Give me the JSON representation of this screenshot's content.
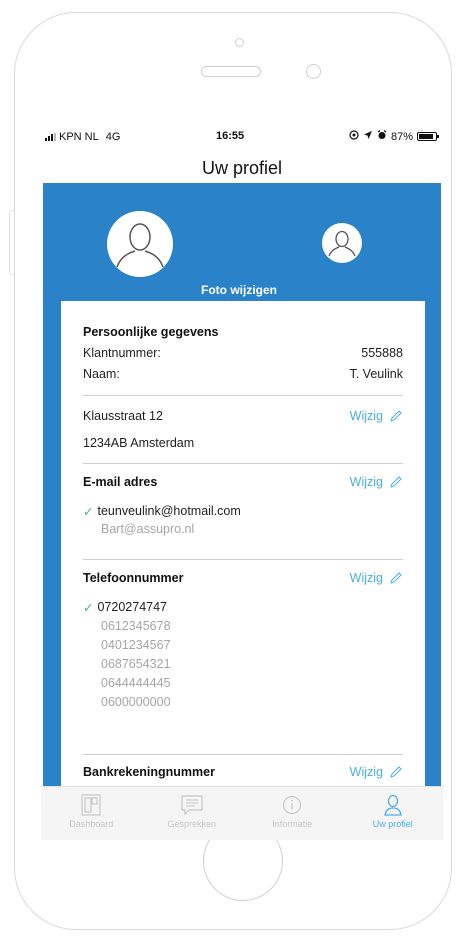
{
  "status_bar": {
    "carrier": "KPN NL",
    "network": "4G",
    "time": "16:55",
    "battery_text": "87%",
    "battery_level": 0.87
  },
  "nav": {
    "title": "Uw profiel"
  },
  "profile": {
    "change_photo_label": "Foto wijzigen"
  },
  "personal": {
    "heading": "Persoonlijke gegevens",
    "customer_number_label": "Klantnummer:",
    "customer_number_value": "555888",
    "name_label": "Naam:",
    "name_value": "T. Veulink"
  },
  "address": {
    "line1": "Klausstraat 12",
    "line2": "1234AB Amsterdam",
    "edit_label": "Wijzig"
  },
  "email": {
    "heading": "E-mail adres",
    "edit_label": "Wijzig",
    "primary": "teunveulink@hotmail.com",
    "others": [
      "Bart@assupro.nl"
    ]
  },
  "phone": {
    "heading": "Telefoonnummer",
    "edit_label": "Wijzig",
    "primary": "0720274747",
    "others": [
      "0612345678",
      "0401234567",
      "0687654321",
      "0644444445",
      "0600000000"
    ]
  },
  "bank": {
    "heading": "Bankrekeningnummer",
    "edit_label": "Wijzig"
  },
  "tabs": [
    {
      "label": "Dashboard",
      "icon": "dashboard-icon",
      "active": false
    },
    {
      "label": "Gesprekken",
      "icon": "chat-icon",
      "active": false
    },
    {
      "label": "Informatie",
      "icon": "info-icon",
      "active": false
    },
    {
      "label": "Uw profiel",
      "icon": "user-icon",
      "active": true
    }
  ],
  "colors": {
    "header_blue": "#2a82c9",
    "link_blue": "#4aaee8",
    "check_green": "#3fb56a"
  }
}
